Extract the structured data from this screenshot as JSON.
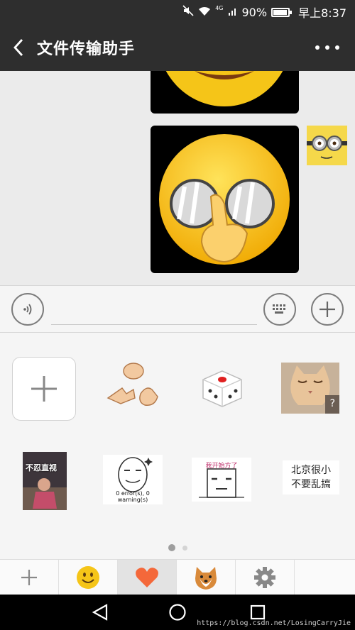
{
  "status_bar": {
    "network": "4G",
    "battery": "90%",
    "time": "早上8:37",
    "icons": [
      "mute-icon",
      "wifi-icon",
      "signal-icon",
      "battery-icon"
    ]
  },
  "header": {
    "title": "文件传输助手",
    "back_icon": "chevron-left-icon",
    "more_icon": "more-dots-icon"
  },
  "chat": {
    "messages": [
      {
        "type": "sticker",
        "content": "yellow-face-emoji-sticker",
        "side": "right"
      },
      {
        "type": "sticker",
        "content": "face-with-glasses-emoji-sticker",
        "side": "right"
      }
    ],
    "avatar": "minion-avatar"
  },
  "input_bar": {
    "voice_icon": "voice-icon",
    "keyboard_icon": "keyboard-icon",
    "plus_icon": "plus-circle-icon"
  },
  "sticker_panel": {
    "items": [
      {
        "name": "add-sticker",
        "icon": "plus-icon"
      },
      {
        "name": "rock-paper-scissors-sticker"
      },
      {
        "name": "dice-sticker"
      },
      {
        "name": "cat-sticker",
        "caption": "?"
      },
      {
        "name": "photo-sticker",
        "caption": "不忍直视"
      },
      {
        "name": "meme-error-sticker",
        "caption": "0 error(s), 0 warning(s)"
      },
      {
        "name": "meme-happy-sticker",
        "caption": "我开始方了"
      },
      {
        "name": "text-sticker",
        "line1": "北京很小",
        "line2": "不要乱搞"
      }
    ],
    "page": 1,
    "pages": 2
  },
  "tab_bar": {
    "tabs": [
      {
        "name": "add",
        "icon": "plus-icon",
        "active": false
      },
      {
        "name": "emoji",
        "icon": "smiley-icon",
        "active": false
      },
      {
        "name": "favorites",
        "icon": "heart-icon",
        "active": true
      },
      {
        "name": "dog-pack",
        "icon": "shiba-dog-icon",
        "active": false
      },
      {
        "name": "settings",
        "icon": "gear-icon",
        "active": false
      }
    ]
  },
  "nav_bar": {
    "icons": [
      "back-triangle-icon",
      "home-circle-icon",
      "recent-square-icon"
    ]
  },
  "watermark": "https://blog.csdn.net/LosingCarryJie",
  "colors": {
    "header_bg": "#2e2e2e",
    "chat_bg": "#ebebeb",
    "heart": "#f4683a",
    "emoji_yellow": "#f5c518"
  }
}
